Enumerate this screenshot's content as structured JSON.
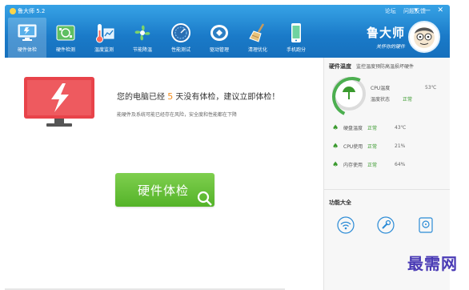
{
  "app": {
    "title": "鲁大师 5.2"
  },
  "top_links": {
    "forum": "论坛",
    "feedback": "问题反馈"
  },
  "window_controls": {
    "menu": "▾",
    "minimize": "—",
    "close": "✕"
  },
  "nav": [
    {
      "label": "硬件体检",
      "icon": "monitor-icon",
      "active": true
    },
    {
      "label": "硬件检测",
      "icon": "chip-icon"
    },
    {
      "label": "温度监测",
      "icon": "thermometer-icon"
    },
    {
      "label": "节能降温",
      "icon": "fan-icon"
    },
    {
      "label": "性能测试",
      "icon": "speedometer-icon"
    },
    {
      "label": "驱动管理",
      "icon": "driver-icon"
    },
    {
      "label": "清理优化",
      "icon": "broom-icon"
    },
    {
      "label": "手机跑分",
      "icon": "phone-icon"
    }
  ],
  "brand": {
    "name": "鲁大师",
    "slogan": "关怀你的硬件"
  },
  "main": {
    "headline_pre": "您的电脑已经",
    "days": "5",
    "headline_post": "天没有体检，建议立即体检！",
    "subline": "能硬件及系统可能已经存在风险，安全度和性能都在下降",
    "check_button": "硬件体检"
  },
  "side": {
    "title": "硬件温度",
    "subtitle": "监控温度预防高温损坏硬件",
    "cpu_temp_label": "CPU温度",
    "cpu_temp_value": "53℃",
    "temp_status_label": "温度状态",
    "temp_status_value": "正常",
    "metrics": [
      {
        "label": "硬盘温度",
        "status": "正常",
        "value": "43℃"
      },
      {
        "label": "CPU使用",
        "status": "正常",
        "value": "21%"
      },
      {
        "label": "内存使用",
        "status": "正常",
        "value": "64%"
      }
    ],
    "functions_title": "功能大全",
    "function_icons": [
      "wifi-icon",
      "wrench-icon",
      "disk-icon"
    ]
  },
  "watermark": "最需网",
  "colors": {
    "header": "#1a7ac8",
    "accent_green": "#54b329",
    "status_green": "#3a9a2e",
    "days_orange": "#f28c1c",
    "monitor_red": "#e8434a"
  }
}
